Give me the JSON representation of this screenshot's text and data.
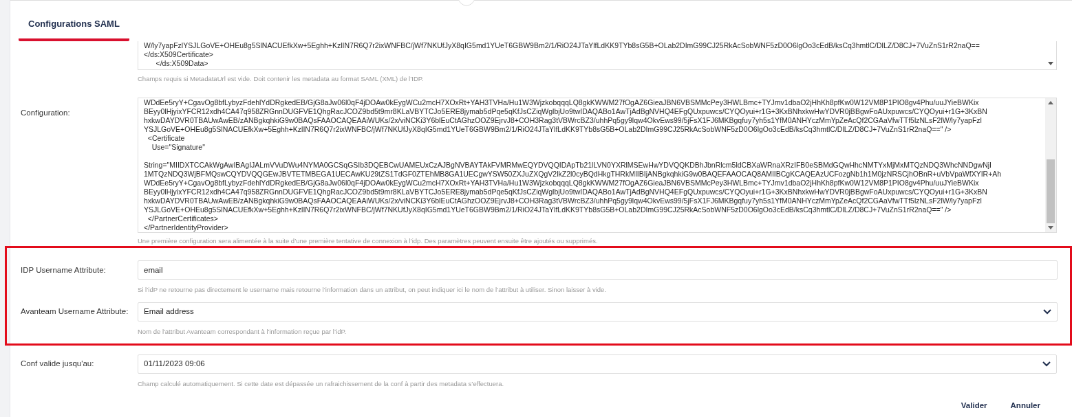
{
  "tab": {
    "label": "Configurations SAML",
    "selected": true
  },
  "metadata": {
    "lines": [
      "W/ly7yapFzlYSJLGoVE+OHEu8g5SlNACUEfkXw+5Eghh+KzlIN7R6Q7r2ixWNFBC/jWf7NKUfJyX8qIG5md1YUeT6GBW9Bm2/1/RiO24JTaYlfLdKK9TYb8sG5B+OLab2DImG99CJ25RkAcSobWNF5zD0O6lgOo3cEdB/ksCq3hmtlC/DlLZ/D8CJ+7VuZnS1rR2naQ==",
      "</ds:X509Certificate>",
      "      </ds:X509Data>"
    ],
    "hint": "Champs requis si MetadataUrl est vide. Doit contenir les metadata au format SAML (XML) de l’IDP."
  },
  "fields": [
    {
      "kind": "textarea",
      "label": "Configuration:",
      "highlighted": false,
      "blocks": [
        [
          "WDdEe5ryY+CgavOg8bfLybyzFdehlYdDRgkedEB/GjG8aJw06l0qF4jDOAw0kEygWCu2mcH7XOxRt+YAH3TVHa/Hu1W3WjzkobqqqLQ8gkKWWM27fOgAZ6GieaJBN6VBSMMcPey3HWLBmc+TYJmv1dbaO2jHhKh8pfKw0W12VM8P1PIO8gv4Phu/uuJYieBWKix",
          "BEyy0lHjyixYFCR12xdh4CA47q958ZRGnnDUGFVE1QhgRacJCOZ9bd5t9mr8KLaVBYTCJo5ERE8jymab5dPqe5qKfJsCZiqWglbjUo9twIDAQABo1AwTjAdBgNVHQ4EFgQUxpuwcs/CYQOyui+r1G+3KxBNhxkwHwYDVR0jBBgwFoAUxpuwcs/CYQOyui+r1G+3KxBN",
          "hxkwDAYDVR0TBAUwAwEB/zANBgkqhkiG9w0BAQsFAAOCAQEAAiWUKs/2x/viNCKi3Y6blEuCtAGhzOOZ9EjrvJ8+COH3Rag3tVBWrcBZ3/uhhPq5gy9lqw4OkvEws99/5jFsX1FJ6MKBgqfuy7yh5s1YfM0ANHYczMmYpZeAcQf2CGAaVfwTTf5lzNLsF2lW/ly7yapFzl",
          "YSJLGoVE+OHEu8g5SlNACUEfkXw+5Eghh+KzlIN7R6Q7r2ixWNFBC/jWf7NKUfJyX8qIG5md1YUeT6GBW9Bm2/1/RiO24JTaYlfLdKK9TYb8sG5B+OLab2DImG99CJ25RkAcSobWNF5zD0O6lgOo3cEdB/ksCq3hmtlC/DlLZ/D8CJ+7VuZnS1rR2naQ==\" />",
          "  <Certificate",
          "    Use=\"Signature\""
        ],
        [
          "String=\"MIIDXTCCAkWgAwIBAgIJALmVVuDWu4NYMA0GCSqGSIb3DQEBCwUAMEUxCzAJBgNVBAYTAkFVMRMwEQYDVQQIDApTb21lLVN0YXRlMSEwHwYDVQQKDBhJbnRlcm5ldCBXaWRnaXRzIFB0eSBMdGQwHhcNMTYxMjMxMTQzNDQ3WhcNNDgwNjI",
          "1MTQzNDQ3WjBFMQswCQYDVQQGEwJBVTETMBEGA1UECAwKU29tZS1TdGF0ZTEhMB8GA1UECgwYSW50ZXJuZXQgV2lkZ2l0cyBQdHkgTHRkMIIBIjANBgkqhkiG9w0BAQEFAAOCAQ8AMIIBCgKCAQEAzUCFozgNb1h1M0jzNRSCjhOBnR+uVbVpaWfXYIR+Ah",
          "WDdEe5ryY+CgavOg8bfLybyzFdehlYdDRgkedEB/GjG8aJw06l0qF4jDOAw0kEygWCu2mcH7XOxRt+YAH3TVHa/Hu1W3WjzkobqqqLQ8gkKWWM27fOgAZ6GieaJBN6VBSMMcPey3HWLBmc+TYJmv1dbaO2jHhKh8pfKw0W12VM8P1PIO8gv4Phu/uuJYieBWKix",
          "BEyy0lHjyixYFCR12xdh4CA47q958ZRGnnDUGFVE1QhgRacJCOZ9bd5t9mr8KLaVBYTCJo5ERE8jymab5dPqe5qKfJsCZiqWglbjUo9twIDAQABo1AwTjAdBgNVHQ4EFgQUxpuwcs/CYQOyui+r1G+3KxBNhxkwHwYDVR0jBBgwFoAUxpuwcs/CYQOyui+r1G+3KxBN",
          "hxkwDAYDVR0TBAUwAwEB/zANBgkqhkiG9w0BAQsFAAOCAQEAAiWUKs/2x/viNCKi3Y6blEuCtAGhzOOZ9EjrvJ8+COH3Rag3tVBWrcBZ3/uhhPq5gy9lqw4OkvEws99/5jFsX1FJ6MKBgqfuy7yh5s1YfM0ANHYczMmYpZeAcQf2CGAaVfwTTf5lzNLsF2lW/ly7yapFzl",
          "YSJLGoVE+OHEu8g5SlNACUEfkXw+5Eghh+KzlIN7R6Q7r2ixWNFBC/jWf7NKUfJyX8qIG5md1YUeT6GBW9Bm2/1/RiO24JTaYlfLdKK9TYb8sG5B+OLab2DImG99CJ25RkAcSobWNF5zD0O6lgOo3cEdB/ksCq3hmtlC/DlLZ/D8CJ+7VuZnS1rR2naQ==\" />",
          "  </PartnerCertificates>",
          "</PartnerIdentityProvider>"
        ]
      ],
      "hint": "Une première configuration sera alimentée à la suite d’une première tentative de connexion à l’idp. Des paramètres peuvent ensuite être ajoutés ou supprimés."
    },
    {
      "kind": "input",
      "label": "IDP Username Attribute:",
      "value": "email",
      "highlighted": true,
      "hint": "Si l’idP ne retourne pas directement le username mais retourne l’information dans un attribut, on peut indiquer ici le nom de l’attribut à utiliser. Sinon laisser à vide."
    },
    {
      "kind": "select",
      "label": "Avanteam Username Attribute:",
      "value": "Email address",
      "highlighted": true,
      "hint": "Nom de l'attribut Avanteam correspondant à l'information reçue par l’idP."
    },
    {
      "kind": "select",
      "label": "Conf valide jusqu'au:",
      "value": "01/11/2023 09:06",
      "highlighted": false,
      "hint": "Champ calculé automatiquement. Si cette date est dépassée un rafraichissement de la conf à partir des metadata s’effectuera."
    }
  ],
  "buttons": [
    "Valider",
    "Annuler"
  ]
}
